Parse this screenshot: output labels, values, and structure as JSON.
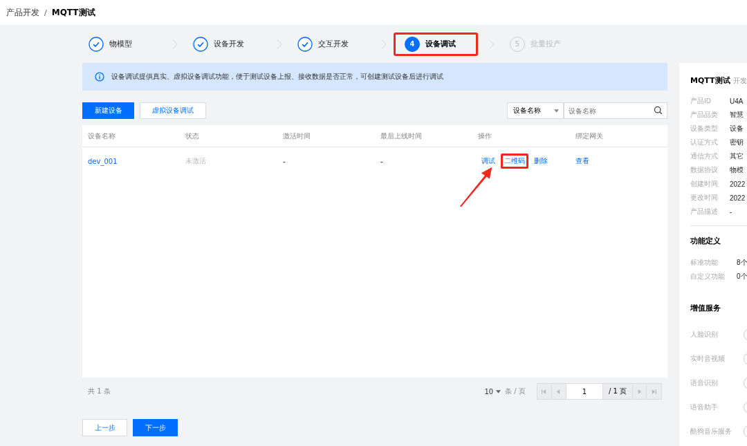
{
  "breadcrumb": {
    "parent": "产品开发",
    "separator": "/",
    "current": "MQTT测试"
  },
  "steps": [
    {
      "label": "物模型",
      "done": true,
      "selected": false,
      "highlighted": false
    },
    {
      "label": "设备开发",
      "done": true,
      "selected": false,
      "highlighted": false
    },
    {
      "label": "交互开发",
      "done": true,
      "selected": false,
      "highlighted": false
    },
    {
      "number": "4",
      "label": "设备调试",
      "done": false,
      "selected": true,
      "highlighted": true
    },
    {
      "number": "5",
      "label": "批量投产",
      "done": false,
      "selected": false,
      "highlighted": false
    }
  ],
  "notice": "设备调试提供真实、虚拟设备调试功能，便于测试设备上报、接收数据是否正常，可创建测试设备后进行调试",
  "toolbar": {
    "primary_button": "新建设备",
    "secondary_button": "虚拟设备调试",
    "filter_select": "设备名称",
    "search": {
      "placeholder": "设备名称"
    }
  },
  "table": {
    "columns": [
      "设备名称",
      "状态",
      "激活时间",
      "最后上线时间",
      "操作",
      "绑定网关"
    ],
    "rows": [
      {
        "name": "dev_001",
        "status": "未激活",
        "activated": "-",
        "last_online": "-",
        "actions": [
          {
            "label": "调试",
            "highlighted": false
          },
          {
            "label": "二维码",
            "highlighted": true
          },
          {
            "label": "删除",
            "highlighted": false
          }
        ],
        "gateway": "查看"
      }
    ]
  },
  "pagination": {
    "total": "共 1 条",
    "page_size": "10",
    "page_size_unit": "条 / 页",
    "page": "1",
    "page_total": "/ 1 页"
  },
  "nav_buttons": {
    "previous": "上一步",
    "next": "下一步"
  },
  "side_panel": {
    "title": "MQTT测试",
    "subtitle": "开发",
    "info": [
      {
        "label": "产品ID",
        "value": "U4A"
      },
      {
        "label": "产品品类",
        "value": "智慧"
      },
      {
        "label": "设备类型",
        "value": "设备"
      },
      {
        "label": "认证方式",
        "value": "密钥"
      },
      {
        "label": "通信方式",
        "value": "其它"
      },
      {
        "label": "数据协议",
        "value": "物模"
      },
      {
        "label": "创建时间",
        "value": "2022"
      },
      {
        "label": "更改时间",
        "value": "2022"
      },
      {
        "label": "产品描述",
        "value": "-"
      }
    ],
    "functions_title": "功能定义",
    "functions": [
      {
        "label": "标准功能",
        "value": "8个"
      },
      {
        "label": "自定义功能",
        "value": "0个"
      }
    ],
    "services_title": "增值服务",
    "services": [
      {
        "label": "人脸识别",
        "on": false
      },
      {
        "label": "实时音视频",
        "on": false
      },
      {
        "label": "语音识别",
        "on": false
      },
      {
        "label": "语音助手",
        "on": false
      },
      {
        "label": "酷狗音乐服务",
        "on": false
      }
    ]
  }
}
